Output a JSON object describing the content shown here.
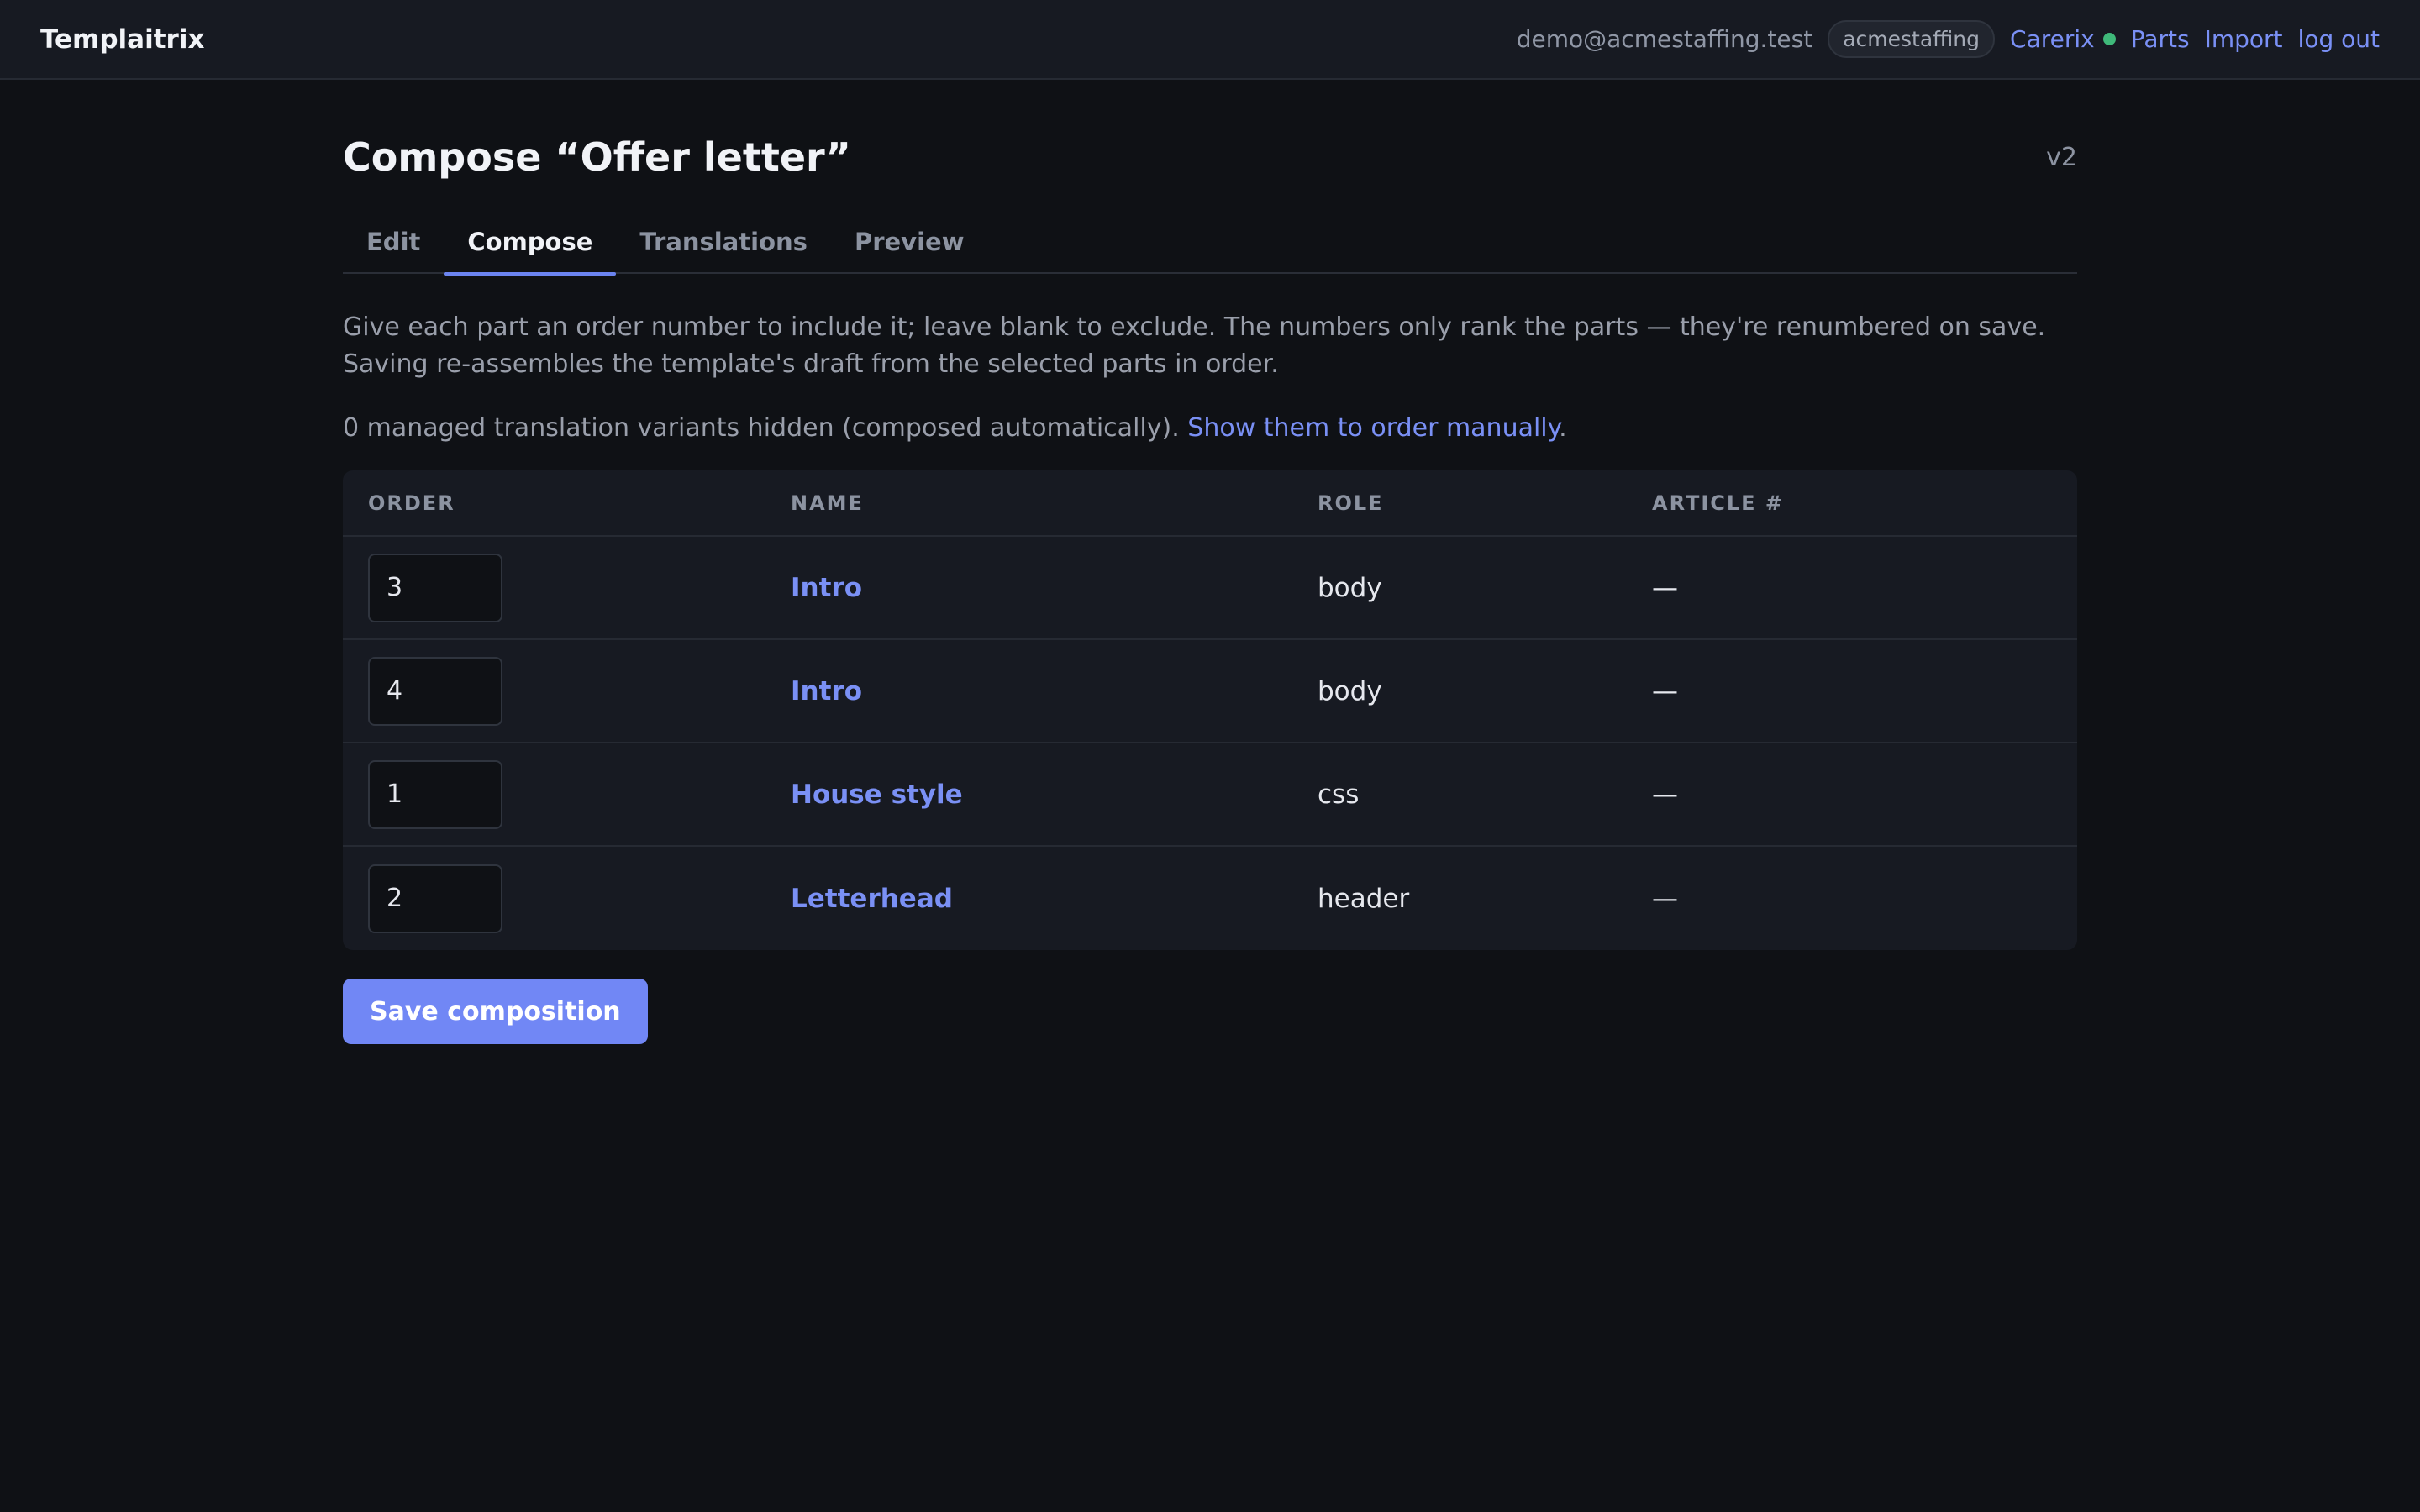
{
  "app": {
    "brand": "Templaitrix"
  },
  "topnav": {
    "user_email": "demo@acmestaffing.test",
    "org": "acmestaffing",
    "carerix": "Carerix",
    "carerix_status_color": "#3fb97a",
    "parts": "Parts",
    "import": "Import",
    "logout": "log out"
  },
  "page": {
    "title": "Compose “Offer letter”",
    "version": "v2"
  },
  "tabs": [
    {
      "label": "Edit",
      "active": false
    },
    {
      "label": "Compose",
      "active": true
    },
    {
      "label": "Translations",
      "active": false
    },
    {
      "label": "Preview",
      "active": false
    }
  ],
  "help": {
    "line1": "Give each part an order number to include it; leave blank to exclude. The numbers only rank the parts — they're renumbered on save.",
    "line2": "Saving re-assembles the template's draft from the selected parts in order.",
    "hidden_note": "0 managed translation variants hidden (composed automatically).",
    "show_link": "Show them to order manually",
    "show_link_suffix": "."
  },
  "table": {
    "headers": {
      "order": "ORDER",
      "name": "NAME",
      "role": "ROLE",
      "article": "ARTICLE #"
    },
    "rows": [
      {
        "order": "3",
        "name": "Intro",
        "role": "body",
        "article": "—"
      },
      {
        "order": "4",
        "name": "Intro",
        "role": "body",
        "article": "—"
      },
      {
        "order": "1",
        "name": "House style",
        "role": "css",
        "article": "—"
      },
      {
        "order": "2",
        "name": "Letterhead",
        "role": "header",
        "article": "—"
      }
    ]
  },
  "actions": {
    "save": "Save composition"
  },
  "colors": {
    "accent": "#7187f5",
    "link": "#7a90f5",
    "background": "#0f1115"
  }
}
